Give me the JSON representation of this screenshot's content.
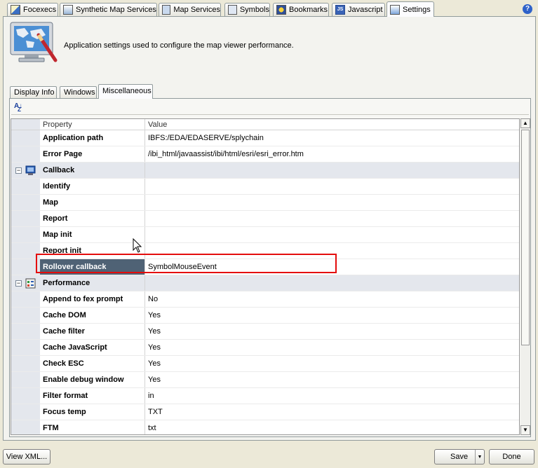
{
  "top_tabs": [
    {
      "label": "Focexecs",
      "icon": "focexec-icon"
    },
    {
      "label": "Synthetic Map Services",
      "icon": "synthetic-map-icon"
    },
    {
      "label": "Map Services",
      "icon": "map-services-icon"
    },
    {
      "label": "Symbols",
      "icon": "symbols-icon"
    },
    {
      "label": "Bookmarks",
      "icon": "bookmarks-icon"
    },
    {
      "label": "Javascript",
      "icon": "javascript-icon"
    },
    {
      "label": "Settings",
      "icon": "settings-icon"
    }
  ],
  "active_top_tab": "Settings",
  "help_label": "?",
  "header": {
    "description": "Application settings used to configure the map viewer performance."
  },
  "inner_tabs": [
    "Display Info",
    "Windows",
    "Miscellaneous"
  ],
  "active_inner_tab": "Miscellaneous",
  "grid": {
    "col_property": "Property",
    "col_value": "Value",
    "rows": [
      {
        "type": "prop",
        "name": "Application path",
        "value": "IBFS:/EDA/EDASERVE/splychain"
      },
      {
        "type": "prop",
        "name": "Error Page",
        "value": "/ibi_html/javaassist/ibi/html/esri/esri_error.htm"
      },
      {
        "type": "cat",
        "name": "Callback",
        "expander": "−"
      },
      {
        "type": "prop",
        "name": "Identify",
        "value": ""
      },
      {
        "type": "prop",
        "name": "Map",
        "value": ""
      },
      {
        "type": "prop",
        "name": "Report",
        "value": ""
      },
      {
        "type": "prop",
        "name": "Map init",
        "value": ""
      },
      {
        "type": "prop",
        "name": "Report init",
        "value": ""
      },
      {
        "type": "prop",
        "name": "Rollover callback",
        "value": "SymbolMouseEvent",
        "selected": true
      },
      {
        "type": "cat",
        "name": "Performance",
        "expander": "−"
      },
      {
        "type": "prop",
        "name": "Append to fex prompt",
        "value": "No"
      },
      {
        "type": "prop",
        "name": "Cache DOM",
        "value": "Yes"
      },
      {
        "type": "prop",
        "name": "Cache filter",
        "value": "Yes"
      },
      {
        "type": "prop",
        "name": "Cache JavaScript",
        "value": "Yes"
      },
      {
        "type": "prop",
        "name": "Check ESC",
        "value": "Yes"
      },
      {
        "type": "prop",
        "name": "Enable debug window",
        "value": "Yes"
      },
      {
        "type": "prop",
        "name": "Filter format",
        "value": "in"
      },
      {
        "type": "prop",
        "name": "Focus temp",
        "value": "TXT"
      },
      {
        "type": "prop",
        "name": "FTM",
        "value": "txt"
      }
    ]
  },
  "buttons": {
    "view_xml": "View XML...",
    "save": "Save",
    "done": "Done"
  },
  "colors": {
    "highlight": "#e40c0c",
    "selected_row": "#4f6275",
    "category_row": "#e4e7ed"
  }
}
